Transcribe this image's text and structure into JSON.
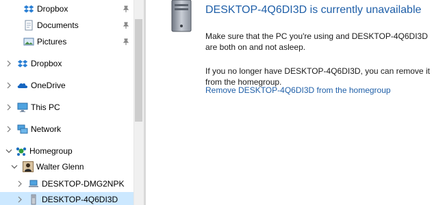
{
  "nav": {
    "quick_access": [
      {
        "label": "Dropbox",
        "icon": "dropbox-icon",
        "pinned": true
      },
      {
        "label": "Documents",
        "icon": "documents-icon",
        "pinned": true
      },
      {
        "label": "Pictures",
        "icon": "pictures-icon",
        "pinned": true
      }
    ],
    "roots": {
      "dropbox": "Dropbox",
      "onedrive": "OneDrive",
      "this_pc": "This PC",
      "network": "Network",
      "homegroup": "Homegroup"
    },
    "homegroup_user": "Walter Glenn",
    "homegroup_pcs": [
      "DESKTOP-DMG2NPK",
      "DESKTOP-4Q6DI3D"
    ],
    "selected": "DESKTOP-4Q6DI3D"
  },
  "main": {
    "title": "DESKTOP-4Q6DI3D is currently unavailable",
    "message1": "Make sure that the PC you're using and DESKTOP-4Q6DI3D are both on and not asleep.",
    "message2": "If you no longer have DESKTOP-4Q6DI3D, you can remove it from the homegroup.",
    "remove_link": "Remove DESKTOP-4Q6DI3D from the homegroup"
  },
  "colors": {
    "accent": "#1f5fa8",
    "selected_bg": "#cce8ff"
  }
}
